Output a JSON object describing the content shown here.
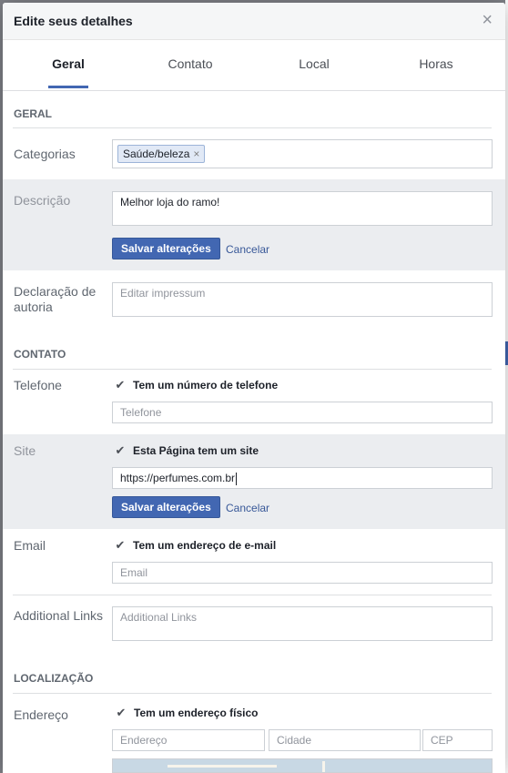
{
  "dialog": {
    "title": "Edite seus detalhes",
    "close_glyph": "×"
  },
  "tabs": [
    {
      "label": "Geral",
      "active": true
    },
    {
      "label": "Contato",
      "active": false
    },
    {
      "label": "Local",
      "active": false
    },
    {
      "label": "Horas",
      "active": false
    }
  ],
  "geral": {
    "section_title": "GERAL",
    "categorias": {
      "label": "Categorias",
      "tag": "Saúde/beleza",
      "tag_remove_glyph": "×"
    },
    "descricao": {
      "label": "Descrição",
      "value": "Melhor loja do ramo!",
      "save_label": "Salvar alterações",
      "cancel_label": "Cancelar"
    },
    "declaracao": {
      "label_line1": "Declaração de",
      "label_line2": "autoria",
      "placeholder": "Editar impressum"
    }
  },
  "contato": {
    "section_title": "CONTATO",
    "telefone": {
      "label": "Telefone",
      "checkbox_label": "Tem um número de telefone",
      "checked": true,
      "placeholder": "Telefone"
    },
    "site": {
      "label": "Site",
      "checkbox_label": "Esta Página tem um site",
      "checked": true,
      "value": "https://perfumes.com.br",
      "save_label": "Salvar alterações",
      "cancel_label": "Cancelar"
    },
    "email": {
      "label": "Email",
      "checkbox_label": "Tem um endereço de e-mail",
      "checked": true,
      "placeholder": "Email"
    },
    "additional_links": {
      "label": "Additional Links",
      "placeholder": "Additional Links"
    }
  },
  "localizacao": {
    "section_title": "LOCALIZAÇÃO",
    "endereco": {
      "label": "Endereço",
      "checkbox_label": "Tem um endereço físico",
      "checked": true,
      "placeholder_endereco": "Endereço",
      "placeholder_cidade": "Cidade",
      "placeholder_cep": "CEP"
    }
  },
  "check_glyph": "✔",
  "colors": {
    "accent": "#4267b2",
    "link": "#385898",
    "gray_row": "#ebedf0"
  }
}
